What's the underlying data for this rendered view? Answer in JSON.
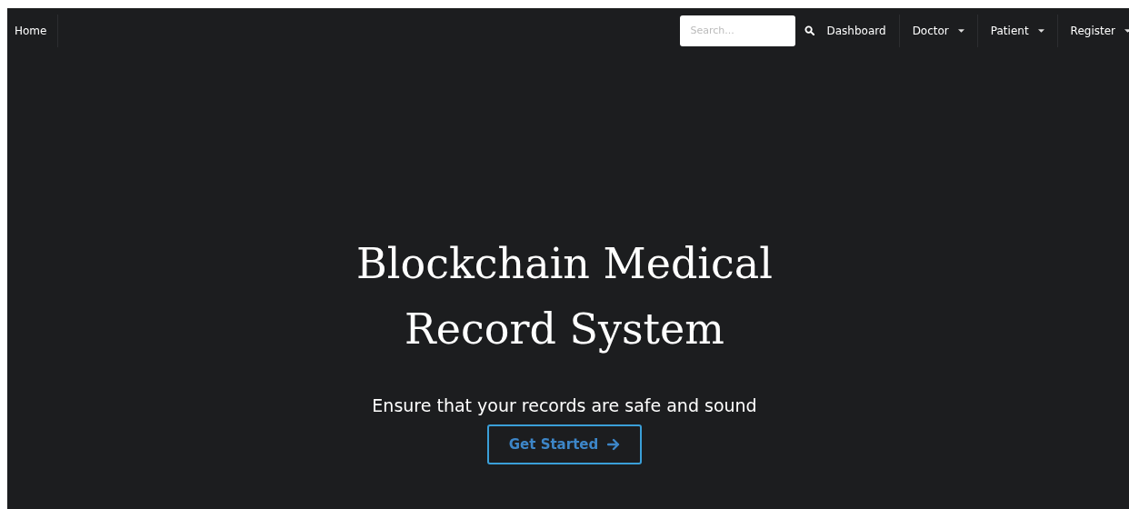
{
  "navbar": {
    "home": "Home",
    "search": {
      "placeholder": "Search..."
    },
    "links": [
      {
        "label": "Dashboard",
        "kind": "link"
      },
      {
        "label": "Doctor",
        "kind": "dropdown"
      },
      {
        "label": "Patient",
        "kind": "dropdown"
      },
      {
        "label": "Register",
        "kind": "dropdown"
      }
    ]
  },
  "hero": {
    "title": "Blockchain Medical Record System",
    "subtitle": "Ensure that your records are safe and sound",
    "button": "Get Started"
  }
}
